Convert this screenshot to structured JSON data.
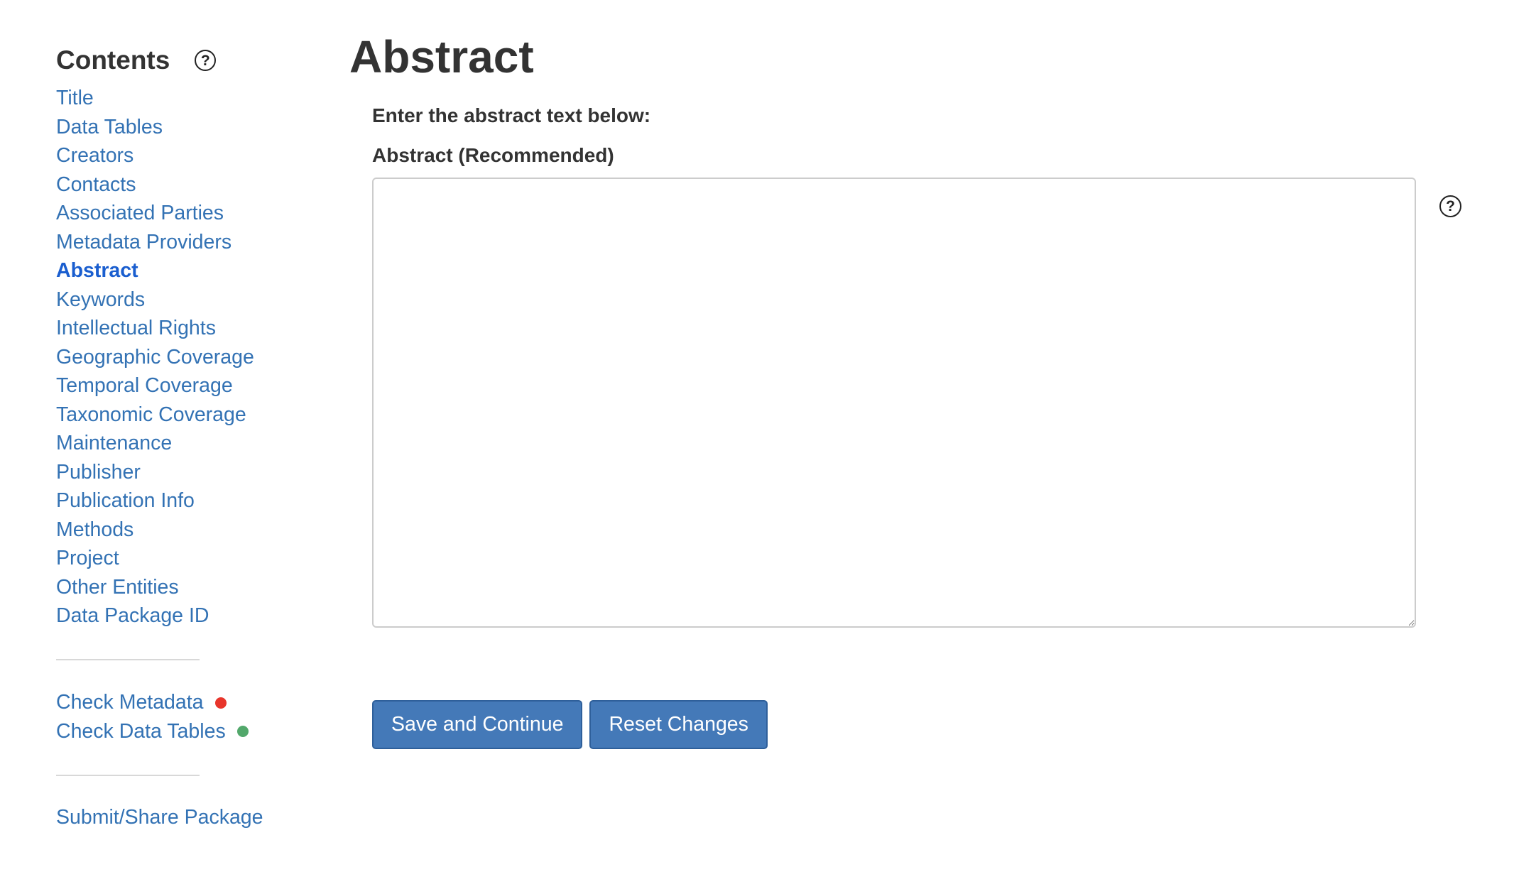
{
  "sidebar": {
    "title": "Contents",
    "items": [
      {
        "label": "Title"
      },
      {
        "label": "Data Tables"
      },
      {
        "label": "Creators"
      },
      {
        "label": "Contacts"
      },
      {
        "label": "Associated Parties"
      },
      {
        "label": "Metadata Providers"
      },
      {
        "label": "Abstract",
        "active": true
      },
      {
        "label": "Keywords"
      },
      {
        "label": "Intellectual Rights"
      },
      {
        "label": "Geographic Coverage"
      },
      {
        "label": "Temporal Coverage"
      },
      {
        "label": "Taxonomic Coverage"
      },
      {
        "label": "Maintenance"
      },
      {
        "label": "Publisher"
      },
      {
        "label": "Publication Info"
      },
      {
        "label": "Methods"
      },
      {
        "label": "Project"
      },
      {
        "label": "Other Entities"
      },
      {
        "label": "Data Package ID"
      }
    ],
    "checks": [
      {
        "label": "Check Metadata",
        "status_color": "#e8352b"
      },
      {
        "label": "Check Data Tables",
        "status_color": "#52a86b"
      }
    ],
    "submit_label": "Submit/Share Package"
  },
  "main": {
    "title": "Abstract",
    "instruction": "Enter the abstract text below:",
    "field_label": "Abstract (Recommended)",
    "abstract_value": "",
    "save_label": "Save and Continue",
    "reset_label": "Reset Changes"
  },
  "icons": {
    "help_glyph": "?"
  },
  "colors": {
    "link": "#3372b4",
    "active_link": "#1a5ecf",
    "button": "#4479b8"
  }
}
